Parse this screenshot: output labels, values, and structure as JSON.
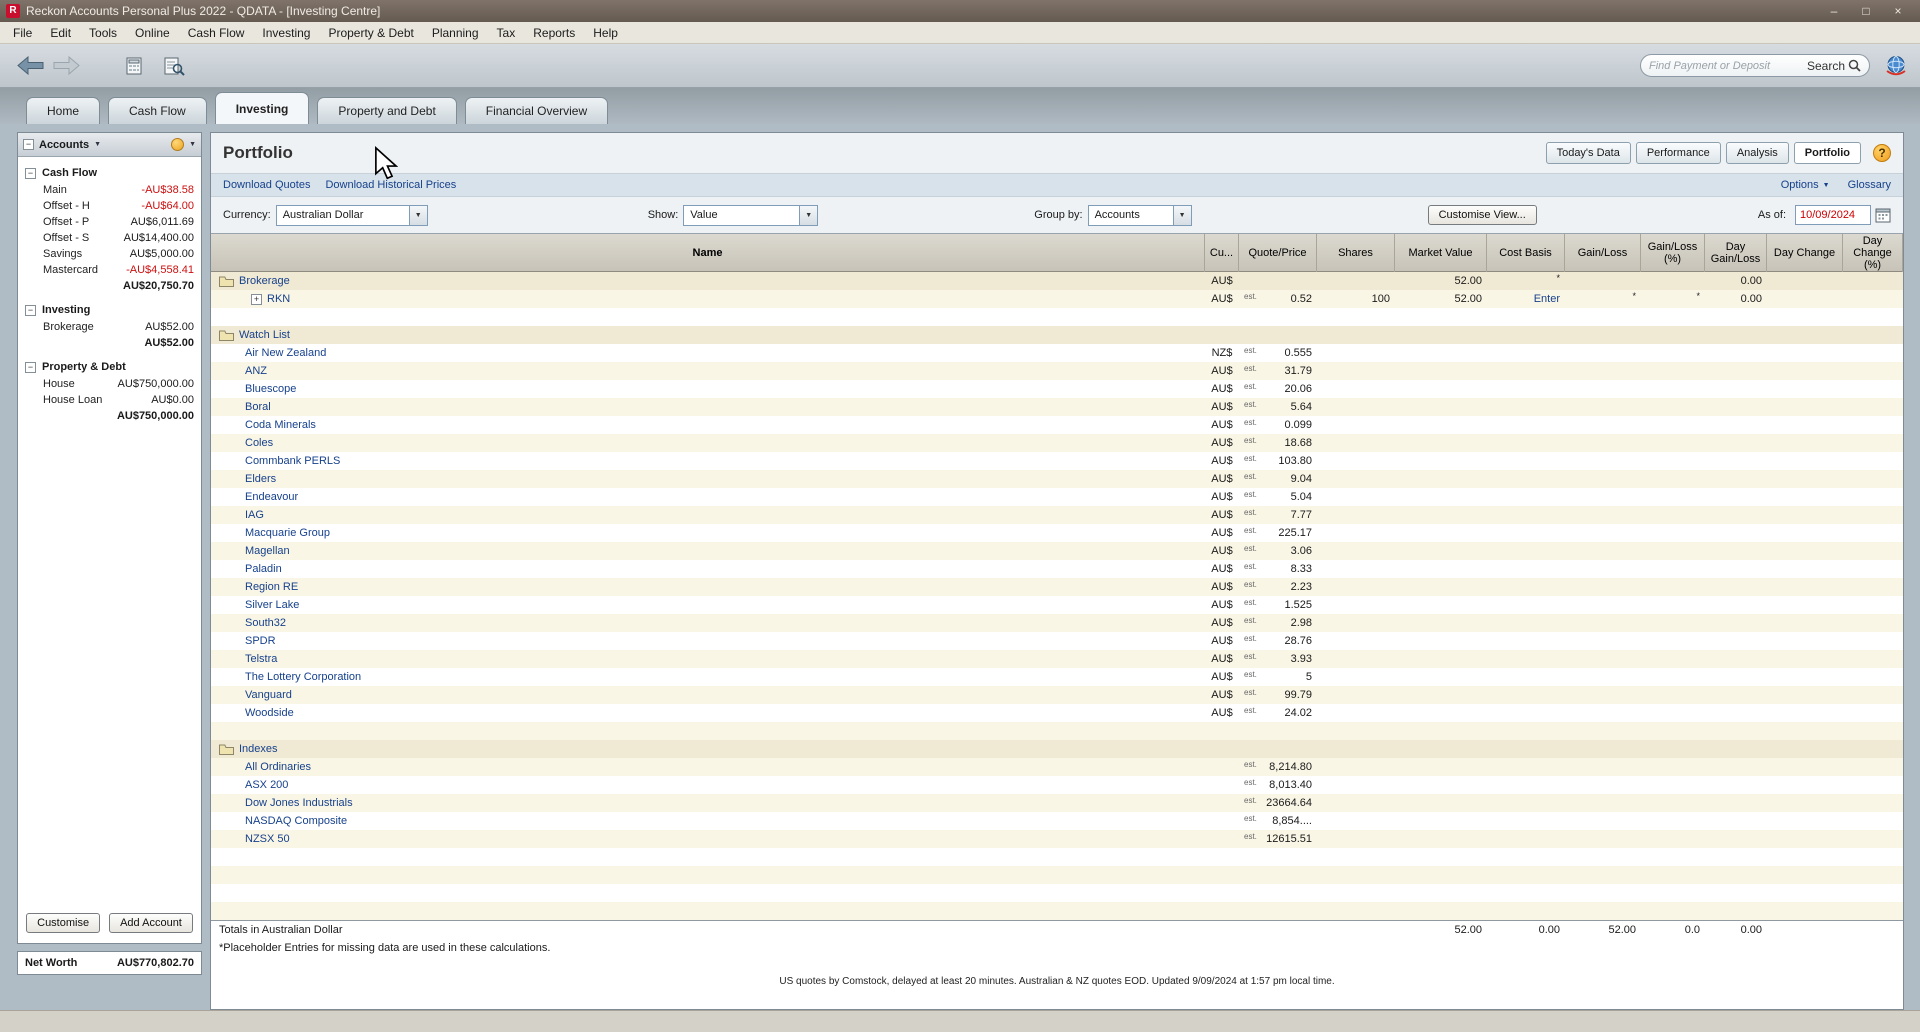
{
  "window": {
    "title": "Reckon Accounts Personal Plus 2022 - QDATA - [Investing Centre]",
    "minimize": "–",
    "maximize": "□",
    "close": "×"
  },
  "menu": {
    "items": [
      "File",
      "Edit",
      "Tools",
      "Online",
      "Cash Flow",
      "Investing",
      "Property & Debt",
      "Planning",
      "Tax",
      "Reports",
      "Help"
    ]
  },
  "toolbar": {
    "search_placeholder": "Find Payment or Deposit",
    "search_label": "Search"
  },
  "tabs": [
    {
      "label": "Home",
      "active": false
    },
    {
      "label": "Cash Flow",
      "active": false
    },
    {
      "label": "Investing",
      "active": true
    },
    {
      "label": "Property and Debt",
      "active": false
    },
    {
      "label": "Financial Overview",
      "active": false
    }
  ],
  "sidebar": {
    "header_label": "Accounts",
    "sections": [
      {
        "title": "Cash Flow",
        "items": [
          {
            "name": "Main",
            "value": "-AU$38.58",
            "negative": true
          },
          {
            "name": "Offset - H",
            "value": "-AU$64.00",
            "negative": true
          },
          {
            "name": "Offset - P",
            "value": "AU$6,011.69",
            "negative": false
          },
          {
            "name": "Offset - S",
            "value": "AU$14,400.00",
            "negative": false
          },
          {
            "name": "Savings",
            "value": "AU$5,000.00",
            "negative": false
          },
          {
            "name": "Mastercard",
            "value": "-AU$4,558.41",
            "negative": true
          }
        ],
        "total": "AU$20,750.70"
      },
      {
        "title": "Investing",
        "items": [
          {
            "name": "Brokerage",
            "value": "AU$52.00",
            "negative": false
          }
        ],
        "total": "AU$52.00"
      },
      {
        "title": "Property & Debt",
        "items": [
          {
            "name": "House",
            "value": "AU$750,000.00",
            "negative": false
          },
          {
            "name": "House Loan",
            "value": "AU$0.00",
            "negative": false
          }
        ],
        "total": "AU$750,000.00"
      }
    ],
    "customise_label": "Customise",
    "add_account_label": "Add Account",
    "net_worth_label": "Net Worth",
    "net_worth_value": "AU$770,802.70"
  },
  "page": {
    "title": "Portfolio",
    "view_buttons": [
      {
        "label": "Today's Data",
        "active": false
      },
      {
        "label": "Performance",
        "active": false
      },
      {
        "label": "Analysis",
        "active": false
      },
      {
        "label": "Portfolio",
        "active": true
      }
    ],
    "help_label": "?",
    "links": [
      "Download Quotes",
      "Download Historical Prices"
    ],
    "options_label": "Options",
    "glossary_label": "Glossary",
    "currency_label": "Currency:",
    "currency_value": "Australian Dollar",
    "show_label": "Show:",
    "show_value": "Value",
    "groupby_label": "Group by:",
    "groupby_value": "Accounts",
    "customise_view_label": "Customise View...",
    "asof_label": "As of:",
    "asof_value": "10/09/2024"
  },
  "table": {
    "columns": [
      "Name",
      "Cu...",
      "Quote/Price",
      "Shares",
      "Market Value",
      "Cost Basis",
      "Gain/Loss",
      "Gain/Loss (%)",
      "Day Gain/Loss",
      "Day Change",
      "Day Change (%)"
    ],
    "rows": [
      {
        "type": "group",
        "name": "Brokerage",
        "currency": "AU$",
        "market_value": "52.00",
        "cost_note": "*",
        "day_gain_loss": "0.00"
      },
      {
        "type": "holding",
        "name": "RKN",
        "currency": "AU$",
        "est": true,
        "quote": "0.52",
        "shares": "100",
        "market_value": "52.00",
        "cost_basis": "Enter",
        "gain_note": "*",
        "gain_pct_note": "*",
        "day_gain_loss": "0.00"
      },
      {
        "type": "spacer"
      },
      {
        "type": "group",
        "name": "Watch List"
      },
      {
        "type": "quote",
        "name": "Air New Zealand",
        "currency": "NZ$",
        "est": true,
        "quote": "0.555"
      },
      {
        "type": "quote",
        "name": "ANZ",
        "currency": "AU$",
        "est": true,
        "quote": "31.79"
      },
      {
        "type": "quote",
        "name": "Bluescope",
        "currency": "AU$",
        "est": true,
        "quote": "20.06"
      },
      {
        "type": "quote",
        "name": "Boral",
        "currency": "AU$",
        "est": true,
        "quote": "5.64"
      },
      {
        "type": "quote",
        "name": "Coda Minerals",
        "currency": "AU$",
        "est": true,
        "quote": "0.099"
      },
      {
        "type": "quote",
        "name": "Coles",
        "currency": "AU$",
        "est": true,
        "quote": "18.68"
      },
      {
        "type": "quote",
        "name": "Commbank PERLS",
        "currency": "AU$",
        "est": true,
        "quote": "103.80"
      },
      {
        "type": "quote",
        "name": "Elders",
        "currency": "AU$",
        "est": true,
        "quote": "9.04"
      },
      {
        "type": "quote",
        "name": "Endeavour",
        "currency": "AU$",
        "est": true,
        "quote": "5.04"
      },
      {
        "type": "quote",
        "name": "IAG",
        "currency": "AU$",
        "est": true,
        "quote": "7.77"
      },
      {
        "type": "quote",
        "name": "Macquarie Group",
        "currency": "AU$",
        "est": true,
        "quote": "225.17"
      },
      {
        "type": "quote",
        "name": "Magellan",
        "currency": "AU$",
        "est": true,
        "quote": "3.06"
      },
      {
        "type": "quote",
        "name": "Paladin",
        "currency": "AU$",
        "est": true,
        "quote": "8.33"
      },
      {
        "type": "quote",
        "name": "Region RE",
        "currency": "AU$",
        "est": true,
        "quote": "2.23"
      },
      {
        "type": "quote",
        "name": "Silver Lake",
        "currency": "AU$",
        "est": true,
        "quote": "1.525"
      },
      {
        "type": "quote",
        "name": "South32",
        "currency": "AU$",
        "est": true,
        "quote": "2.98"
      },
      {
        "type": "quote",
        "name": "SPDR",
        "currency": "AU$",
        "est": true,
        "quote": "28.76"
      },
      {
        "type": "quote",
        "name": "Telstra",
        "currency": "AU$",
        "est": true,
        "quote": "3.93"
      },
      {
        "type": "quote",
        "name": "The Lottery Corporation",
        "currency": "AU$",
        "est": true,
        "quote": "5"
      },
      {
        "type": "quote",
        "name": "Vanguard",
        "currency": "AU$",
        "est": true,
        "quote": "99.79"
      },
      {
        "type": "quote",
        "name": "Woodside",
        "currency": "AU$",
        "est": true,
        "quote": "24.02"
      },
      {
        "type": "spacer"
      },
      {
        "type": "group",
        "name": "Indexes"
      },
      {
        "type": "quote",
        "name": "All Ordinaries",
        "est": true,
        "quote": "8,214.80"
      },
      {
        "type": "quote",
        "name": "ASX 200",
        "est": true,
        "quote": "8,013.40"
      },
      {
        "type": "quote",
        "name": "Dow Jones Industrials",
        "est": true,
        "quote": "23664.64"
      },
      {
        "type": "quote",
        "name": "NASDAQ Composite",
        "est": true,
        "quote": "8,854...."
      },
      {
        "type": "quote",
        "name": "NZSX 50",
        "est": true,
        "quote": "12615.51"
      },
      {
        "type": "spacer"
      },
      {
        "type": "spacer"
      },
      {
        "type": "spacer"
      },
      {
        "type": "spacer"
      }
    ],
    "totals": {
      "label": "Totals in Australian Dollar",
      "market_value": "52.00",
      "cost_basis": "0.00",
      "gain_loss": "52.00",
      "gain_loss_pct": "0.0",
      "day_gain_loss": "0.00"
    },
    "footnote": "*Placeholder Entries for missing data are used in these calculations.",
    "status": "US quotes by Comstock, delayed at least 20 minutes. Australian & NZ quotes EOD. Updated 9/09/2024 at 1:57 pm local time."
  }
}
